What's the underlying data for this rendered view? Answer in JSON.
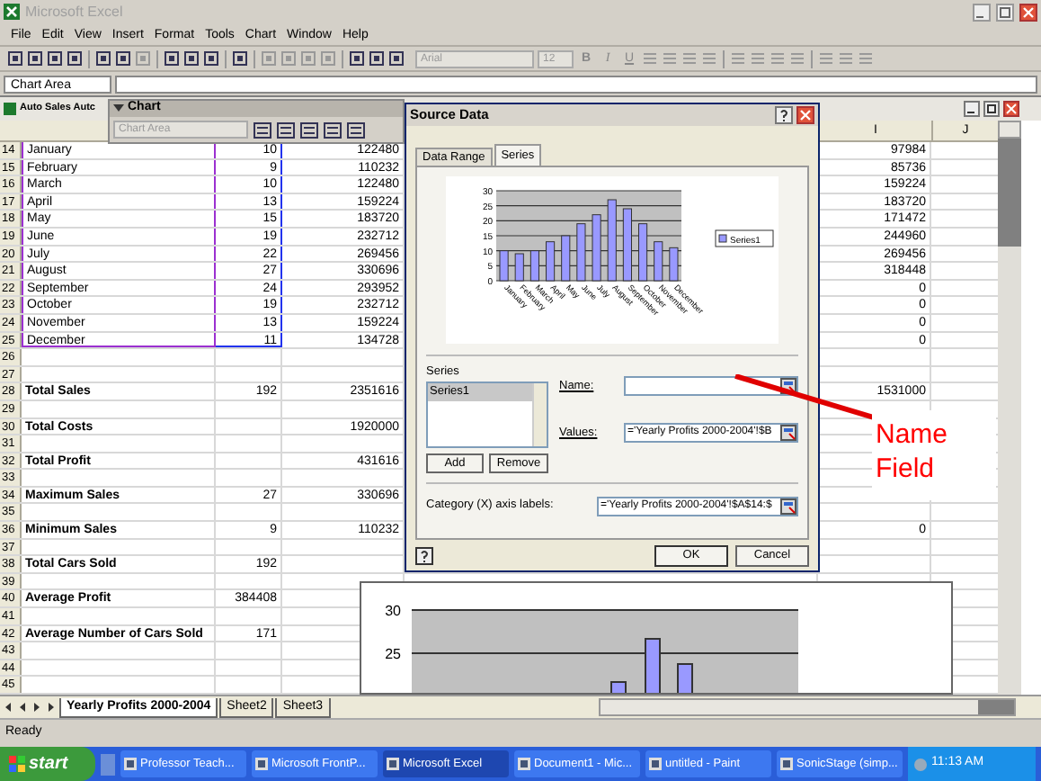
{
  "app_window": {
    "title": "Microsoft Excel"
  },
  "menu": [
    "File",
    "Edit",
    "View",
    "Insert",
    "Format",
    "Tools",
    "Chart",
    "Window",
    "Help"
  ],
  "toolbar": {
    "font": "Arial",
    "size": "12",
    "format_buttons": [
      "B",
      "I",
      "U"
    ]
  },
  "formula_bar": {
    "name_box": "Chart Area"
  },
  "workbook": {
    "title": "Auto Sales Autc",
    "columns": [
      {
        "label": "I"
      },
      {
        "label": "J"
      }
    ],
    "rows": [
      {
        "number": "14",
        "kind": "data",
        "a": "January",
        "b": "10",
        "c": "122480",
        "i": "97984"
      },
      {
        "number": "15",
        "kind": "data",
        "a": "February",
        "b": "9",
        "c": "110232",
        "i": "85736"
      },
      {
        "number": "16",
        "kind": "data",
        "a": "March",
        "b": "10",
        "c": "122480",
        "i": "159224"
      },
      {
        "number": "17",
        "kind": "data",
        "a": "April",
        "b": "13",
        "c": "159224",
        "i": "183720"
      },
      {
        "number": "18",
        "kind": "data",
        "a": "May",
        "b": "15",
        "c": "183720",
        "i": "171472"
      },
      {
        "number": "19",
        "kind": "data",
        "a": "June",
        "b": "19",
        "c": "232712",
        "i": "244960"
      },
      {
        "number": "20",
        "kind": "data",
        "a": "July",
        "b": "22",
        "c": "269456",
        "i": "269456"
      },
      {
        "number": "21",
        "kind": "data",
        "a": "August",
        "b": "27",
        "c": "330696",
        "i": "318448"
      },
      {
        "number": "22",
        "kind": "data",
        "a": "September",
        "b": "24",
        "c": "293952",
        "i": "0"
      },
      {
        "number": "23",
        "kind": "data",
        "a": "October",
        "b": "19",
        "c": "232712",
        "i": "0"
      },
      {
        "number": "24",
        "kind": "data",
        "a": "November",
        "b": "13",
        "c": "159224",
        "i": "0"
      },
      {
        "number": "25",
        "kind": "data",
        "a": "December",
        "b": "11",
        "c": "134728",
        "i": "0"
      },
      {
        "number": "26",
        "kind": "blank"
      },
      {
        "number": "27",
        "kind": "blank"
      },
      {
        "number": "28",
        "kind": "total",
        "a": "Total Sales",
        "b": "192",
        "c": "2351616",
        "i": "1531000"
      },
      {
        "number": "29",
        "kind": "blank"
      },
      {
        "number": "30",
        "kind": "total",
        "a": "Total Costs",
        "c": "1920000"
      },
      {
        "number": "31",
        "kind": "blank"
      },
      {
        "number": "32",
        "kind": "total",
        "a": "Total Profit",
        "c": "431616"
      },
      {
        "number": "33",
        "kind": "blank"
      },
      {
        "number": "34",
        "kind": "total",
        "a": "Maximum Sales",
        "b": "27",
        "c": "330696"
      },
      {
        "number": "35",
        "kind": "blank"
      },
      {
        "number": "36",
        "kind": "total",
        "a": "Minimum Sales",
        "b": "9",
        "c": "110232",
        "i": "0"
      },
      {
        "number": "37",
        "kind": "blank"
      },
      {
        "number": "38",
        "kind": "total",
        "a": "Total Cars Sold",
        "b": "192"
      },
      {
        "number": "39",
        "kind": "blank"
      },
      {
        "number": "40",
        "kind": "total",
        "a": "Average Profit",
        "b": "384408"
      },
      {
        "number": "41",
        "kind": "blank"
      },
      {
        "number": "42",
        "kind": "total",
        "a": "Average Number of Cars Sold",
        "b": "171"
      },
      {
        "number": "43",
        "kind": "blank"
      },
      {
        "number": "44",
        "kind": "blank"
      },
      {
        "number": "45",
        "kind": "blank"
      }
    ]
  },
  "chart_toolbar": {
    "title": "Chart",
    "object": "Chart Area"
  },
  "dialog": {
    "title": "Source Data",
    "tabs": [
      {
        "label": "Data Range",
        "selected": false
      },
      {
        "label": "Series",
        "selected": true
      }
    ],
    "preview": {
      "chart_data": {
        "type": "bar",
        "grid": true,
        "categories": [
          "January",
          "February",
          "March",
          "April",
          "May",
          "June",
          "July",
          "August",
          "September",
          "October",
          "November",
          "December"
        ],
        "series": [
          {
            "name": "Series1",
            "color": "#9999ff",
            "values": [
              10,
              9,
              10,
              13,
              15,
              19,
              22,
              27,
              24,
              19,
              13,
              11
            ]
          }
        ],
        "ylim": [
          0,
          30
        ],
        "yticks": [
          0,
          5,
          10,
          15,
          20,
          25,
          30
        ]
      }
    },
    "series_label": "Series",
    "series": [
      {
        "label": "Series1",
        "selected": true
      }
    ],
    "add": "Add",
    "remove": "Remove",
    "name_label": "Name:",
    "values_label": "Values:",
    "values_value": "='Yearly Profits 2000-2004'!$B",
    "category_label": "Category (X) axis labels:",
    "category_value": "='Yearly Profits 2000-2004'!$A$14:$",
    "ok": "OK",
    "cancel": "Cancel"
  },
  "embedded_chart": {
    "tick_labels": [
      "30",
      "25"
    ]
  },
  "annotation": {
    "text": "Name Field"
  },
  "sheet_tabs": [
    {
      "label": "Yearly Profits 2000-2004",
      "selected": true
    },
    {
      "label": "Sheet2",
      "selected": false
    },
    {
      "label": "Sheet3",
      "selected": false
    }
  ],
  "status_bar": {
    "text": "Ready"
  },
  "taskbar": {
    "start": "start",
    "items": [
      {
        "label": "Professor Teach...",
        "selected": false
      },
      {
        "label": "Microsoft FrontP...",
        "selected": false
      },
      {
        "label": "Microsoft Excel",
        "selected": true
      },
      {
        "label": "Document1 - Mic...",
        "selected": false
      },
      {
        "label": "untitled - Paint",
        "selected": false
      },
      {
        "label": "SonicStage (simp...",
        "selected": false
      }
    ],
    "clock": "11:13 AM"
  }
}
